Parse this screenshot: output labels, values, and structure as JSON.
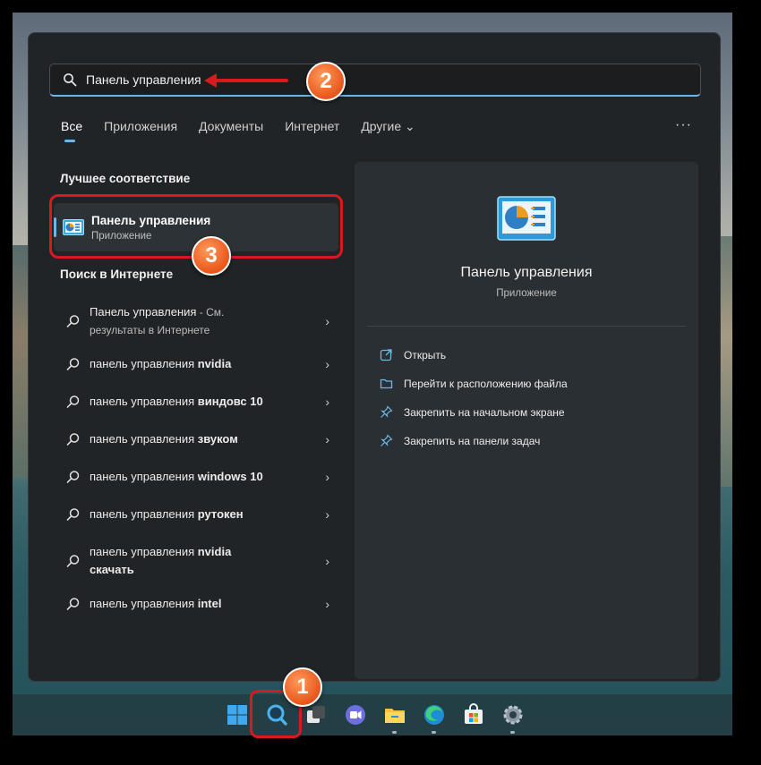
{
  "search": {
    "query": "Панель управления"
  },
  "tabs": [
    {
      "label": "Все"
    },
    {
      "label": "Приложения"
    },
    {
      "label": "Документы"
    },
    {
      "label": "Интернет"
    },
    {
      "label": "Другие ⌄"
    }
  ],
  "more_label": "···",
  "best_match": {
    "section_title": "Лучшее соответствие",
    "title": "Панель управления",
    "subtitle": "Приложение"
  },
  "web_search": {
    "section_title": "Поиск в Интернете",
    "items": [
      {
        "text": "Панель управления",
        "suffix": " - См.",
        "line2": "результаты в Интернете"
      },
      {
        "text": "панель управления ",
        "bold": "nvidia"
      },
      {
        "text": "панель управления ",
        "bold": "виндовс 10"
      },
      {
        "text": "панель управления ",
        "bold": "звуком"
      },
      {
        "text": "панель управления ",
        "bold": "windows 10"
      },
      {
        "text": "панель управления ",
        "bold": "рутокен"
      },
      {
        "text": "панель управления ",
        "bold": "nvidia",
        "line2": "скачать"
      },
      {
        "text": "панель управления ",
        "bold": "intel"
      }
    ]
  },
  "preview": {
    "title": "Панель управления",
    "subtitle": "Приложение",
    "actions": [
      {
        "label": "Открыть",
        "icon": "open-icon"
      },
      {
        "label": "Перейти к расположению файла",
        "icon": "folder-icon"
      },
      {
        "label": "Закрепить на начальном экране",
        "icon": "pin-icon"
      },
      {
        "label": "Закрепить на панели задач",
        "icon": "pin-icon"
      }
    ]
  },
  "callouts": {
    "one": "1",
    "two": "2",
    "three": "3"
  },
  "taskbar": {
    "icons": [
      "windows-start-icon",
      "search-icon",
      "task-view-icon",
      "teams-chat-icon",
      "file-explorer-icon",
      "edge-icon",
      "store-icon",
      "settings-icon"
    ]
  },
  "colors": {
    "accent": "#6fb6e5",
    "highlight_red": "#d8191f",
    "badge_orange": "#e8561c"
  }
}
